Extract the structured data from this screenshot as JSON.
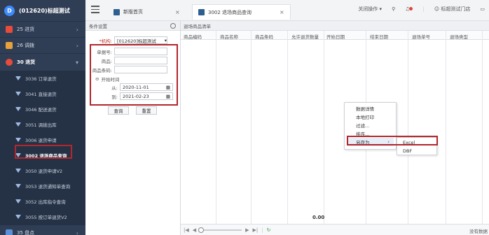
{
  "brand": {
    "title": "(012620)标超测试",
    "logo": "D"
  },
  "sidebar": {
    "groups": [
      {
        "label": "25 进货",
        "color": "#e84b3c"
      },
      {
        "label": "26 调拨",
        "color": "#e8a13c"
      },
      {
        "label": "30 退货",
        "color": "#e84b3c"
      }
    ],
    "sub_items": [
      "3036 订单退货",
      "3041 直接退货",
      "3046 配送退货",
      "3051 调拨出库",
      "3006 退货申请",
      "3002 退场商品查询",
      "3050 退货申请V2",
      "3053 退货通知单查询",
      "3052 出库指令查询",
      "3055 按订单退货V2"
    ],
    "bottom_group": {
      "label": "35 盘点",
      "color": "#5b8fd6"
    }
  },
  "topbar": {
    "tabs": [
      {
        "label": "新版首页"
      },
      {
        "label": "3002 退场商品查询"
      }
    ],
    "close_ops": "关闭操作 ▾",
    "store": "标超测试门店"
  },
  "conditions": {
    "header": "条件设置",
    "org_label": "*机构:",
    "org_value": "[012620]标超测试",
    "doc_label": "单据号:",
    "goods_label": "商品:",
    "barcode_label": "商品条码:",
    "start_time_label": "开始时间",
    "from_label": "从:",
    "from_value": "2020-11-01",
    "to_label": "到:",
    "to_value": "2021-02-23",
    "query_btn": "查询",
    "reset_btn": "重置"
  },
  "grid": {
    "title": "退场商品清单",
    "columns": [
      "商品编码",
      "商品名称",
      "商品条码",
      "允许退货数量",
      "开始日期",
      "结束日期",
      "退场单号",
      "退场类型"
    ],
    "total": "0.00",
    "no_data": "没有数据"
  },
  "context_menu": {
    "items": [
      "数据详情",
      "本地打印",
      "过滤...",
      "排序...",
      "另存为"
    ],
    "submenu": [
      "Excel",
      "DBF"
    ]
  }
}
